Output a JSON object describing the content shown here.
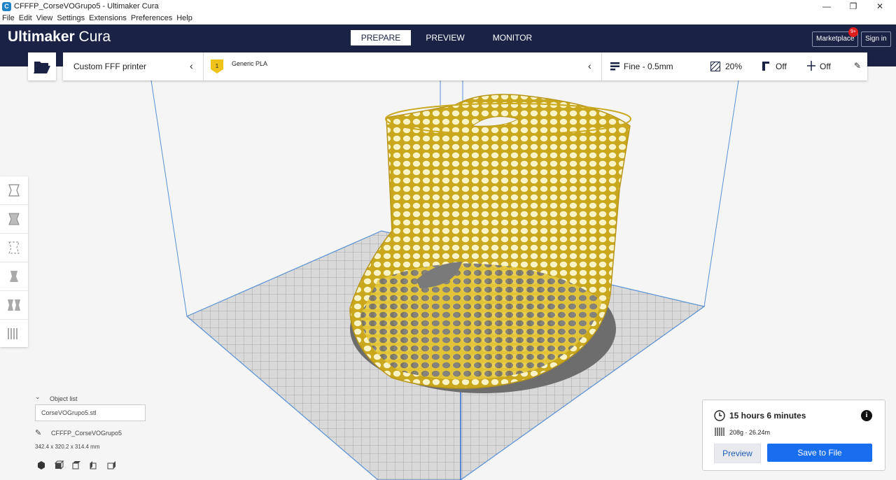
{
  "window": {
    "title": "CFFFP_CorseVOGrupo5 - Ultimaker Cura",
    "app_icon_letter": "C",
    "controls": [
      "—",
      "❐",
      "✕"
    ]
  },
  "menu": [
    "File",
    "Edit",
    "View",
    "Settings",
    "Extensions",
    "Preferences",
    "Help"
  ],
  "header": {
    "brand_bold": "Ultimaker",
    "brand_light": " Cura",
    "tabs": [
      {
        "label": "PREPARE",
        "active": true
      },
      {
        "label": "PREVIEW",
        "active": false
      },
      {
        "label": "MONITOR",
        "active": false
      }
    ],
    "marketplace_label": "Marketplace",
    "marketplace_badge": "9+",
    "signin_label": "Sign in"
  },
  "toolbar": {
    "printer": "Custom FFF printer",
    "extruder_number": "1",
    "material": "Generic PLA",
    "profile": "Fine - 0.5mm",
    "infill": "20%",
    "support": "Off",
    "adhesion": "Off"
  },
  "tools": [
    "move-tool-icon",
    "scale-tool-icon",
    "rotate-tool-icon",
    "mirror-tool-icon",
    "per-model-settings-icon",
    "support-blocker-icon"
  ],
  "object_list": {
    "header": "Object list",
    "selected_file": "CorseVOGrupo5.stl",
    "job_name": "CFFFP_CorseVOGrupo5",
    "dimensions": "342.4 x 320.2 x 314.4 mm",
    "view_icons": [
      "3d-view-icon",
      "front-view-icon",
      "top-view-icon",
      "left-view-icon",
      "right-view-icon"
    ]
  },
  "print_info": {
    "time": "15 hours 6 minutes",
    "material_usage": "208g · 26.24m",
    "preview_label": "Preview",
    "save_label": "Save to File"
  },
  "colors": {
    "header_bg": "#1a2345",
    "model_yellow": "#f4e27a",
    "model_outline": "#c9a81e",
    "accent_blue": "#196ef0"
  }
}
